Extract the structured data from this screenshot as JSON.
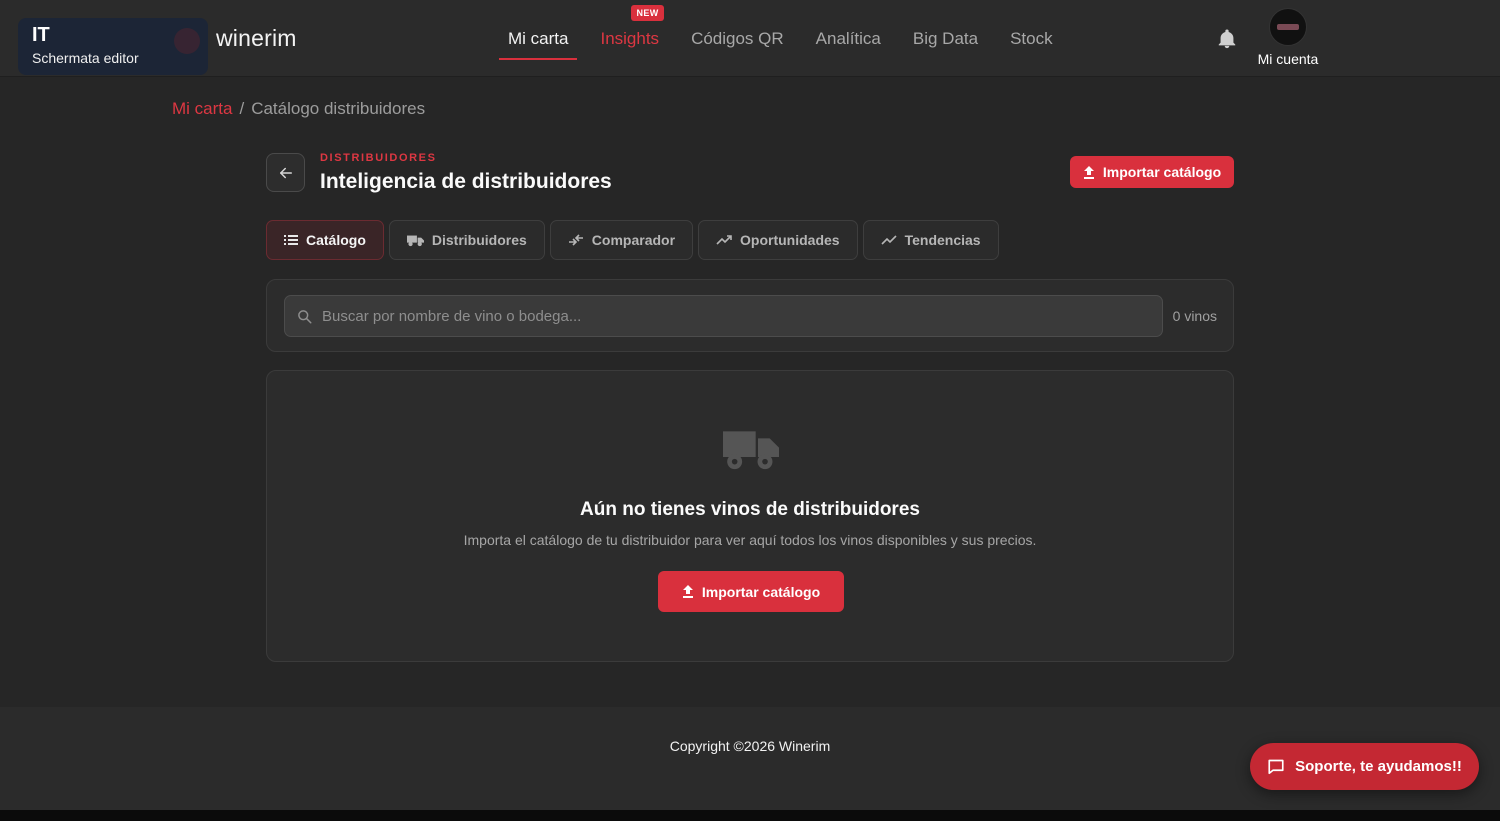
{
  "header": {
    "language": {
      "code": "IT",
      "subtitle": "Schermata editor"
    },
    "brand": "winerim",
    "nav": [
      {
        "label": "Mi carta",
        "active": true
      },
      {
        "label": "Insights",
        "badge": "NEW"
      },
      {
        "label": "Códigos QR"
      },
      {
        "label": "Analítica"
      },
      {
        "label": "Big Data"
      },
      {
        "label": "Stock"
      }
    ],
    "notifications_icon": "bell-icon",
    "account_label": "Mi cuenta"
  },
  "breadcrumb": {
    "link": "Mi carta",
    "separator": "/",
    "current": "Catálogo distribuidores"
  },
  "page": {
    "eyebrow": "DISTRIBUIDORES",
    "title": "Inteligencia de distribuidores",
    "import_button": "Importar catálogo"
  },
  "tabs": [
    {
      "label": "Catálogo",
      "icon": "list-icon",
      "active": true
    },
    {
      "label": "Distribuidores",
      "icon": "truck-icon"
    },
    {
      "label": "Comparador",
      "icon": "compare-arrows-icon"
    },
    {
      "label": "Oportunidades",
      "icon": "trending-up-icon"
    },
    {
      "label": "Tendencias",
      "icon": "trending-up-icon"
    }
  ],
  "search": {
    "placeholder": "Buscar por nombre de vino o bodega...",
    "value": "",
    "count": "0 vinos"
  },
  "empty_state": {
    "icon": "truck-icon",
    "title": "Aún no tienes vinos de distribuidores",
    "description": "Importa el catálogo de tu distribuidor para ver aquí todos los vinos disponibles y sus precios.",
    "button": "Importar catálogo"
  },
  "footer": {
    "copyright": "Copyright ©2026 Winerim"
  },
  "support": {
    "label": "Soporte, te ayudamos!!",
    "icon": "chat-icon"
  },
  "colors": {
    "accent": "#d9303d",
    "background": "#262626",
    "card": "#2c2c2c"
  }
}
